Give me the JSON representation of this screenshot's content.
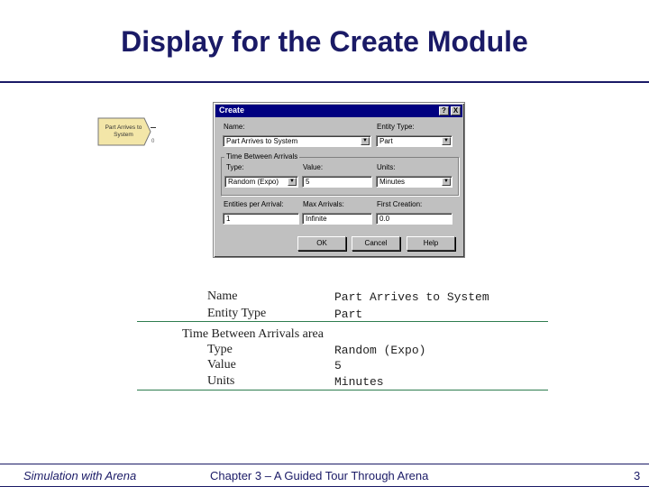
{
  "slide": {
    "title": "Display for the Create Module"
  },
  "module": {
    "label_line1": "Part Arrives to",
    "label_line2": "System",
    "count": "0"
  },
  "dialog": {
    "title": "Create",
    "help_button": "?",
    "close_button": "X",
    "name_label": "Name:",
    "name_value": "Part Arrives to System",
    "entity_type_label": "Entity Type:",
    "entity_type_value": "Part",
    "group_title": "Time Between Arrivals",
    "type_label": "Type:",
    "type_value": "Random (Expo)",
    "value_label": "Value:",
    "value_value": "5",
    "units_label": "Units:",
    "units_value": "Minutes",
    "entities_per_arrival_label": "Entities per Arrival:",
    "entities_per_arrival_value": "1",
    "max_arrivals_label": "Max Arrivals:",
    "max_arrivals_value": "Infinite",
    "first_creation_label": "First Creation:",
    "first_creation_value": "0.0",
    "ok_button": "OK",
    "cancel_button": "Cancel",
    "help_text_button": "Help"
  },
  "table": {
    "name_label": "Name",
    "name_value": "Part Arrives to System",
    "entity_type_label": "Entity Type",
    "entity_type_value": "Part",
    "section_label": "Time Between Arrivals area",
    "type_label": "Type",
    "type_value": "Random (Expo)",
    "value_label": "Value",
    "value_value": "5",
    "units_label": "Units",
    "units_value": "Minutes"
  },
  "footer": {
    "left": "Simulation with Arena",
    "center": "Chapter 3 – A Guided Tour Through Arena",
    "page": "3"
  }
}
